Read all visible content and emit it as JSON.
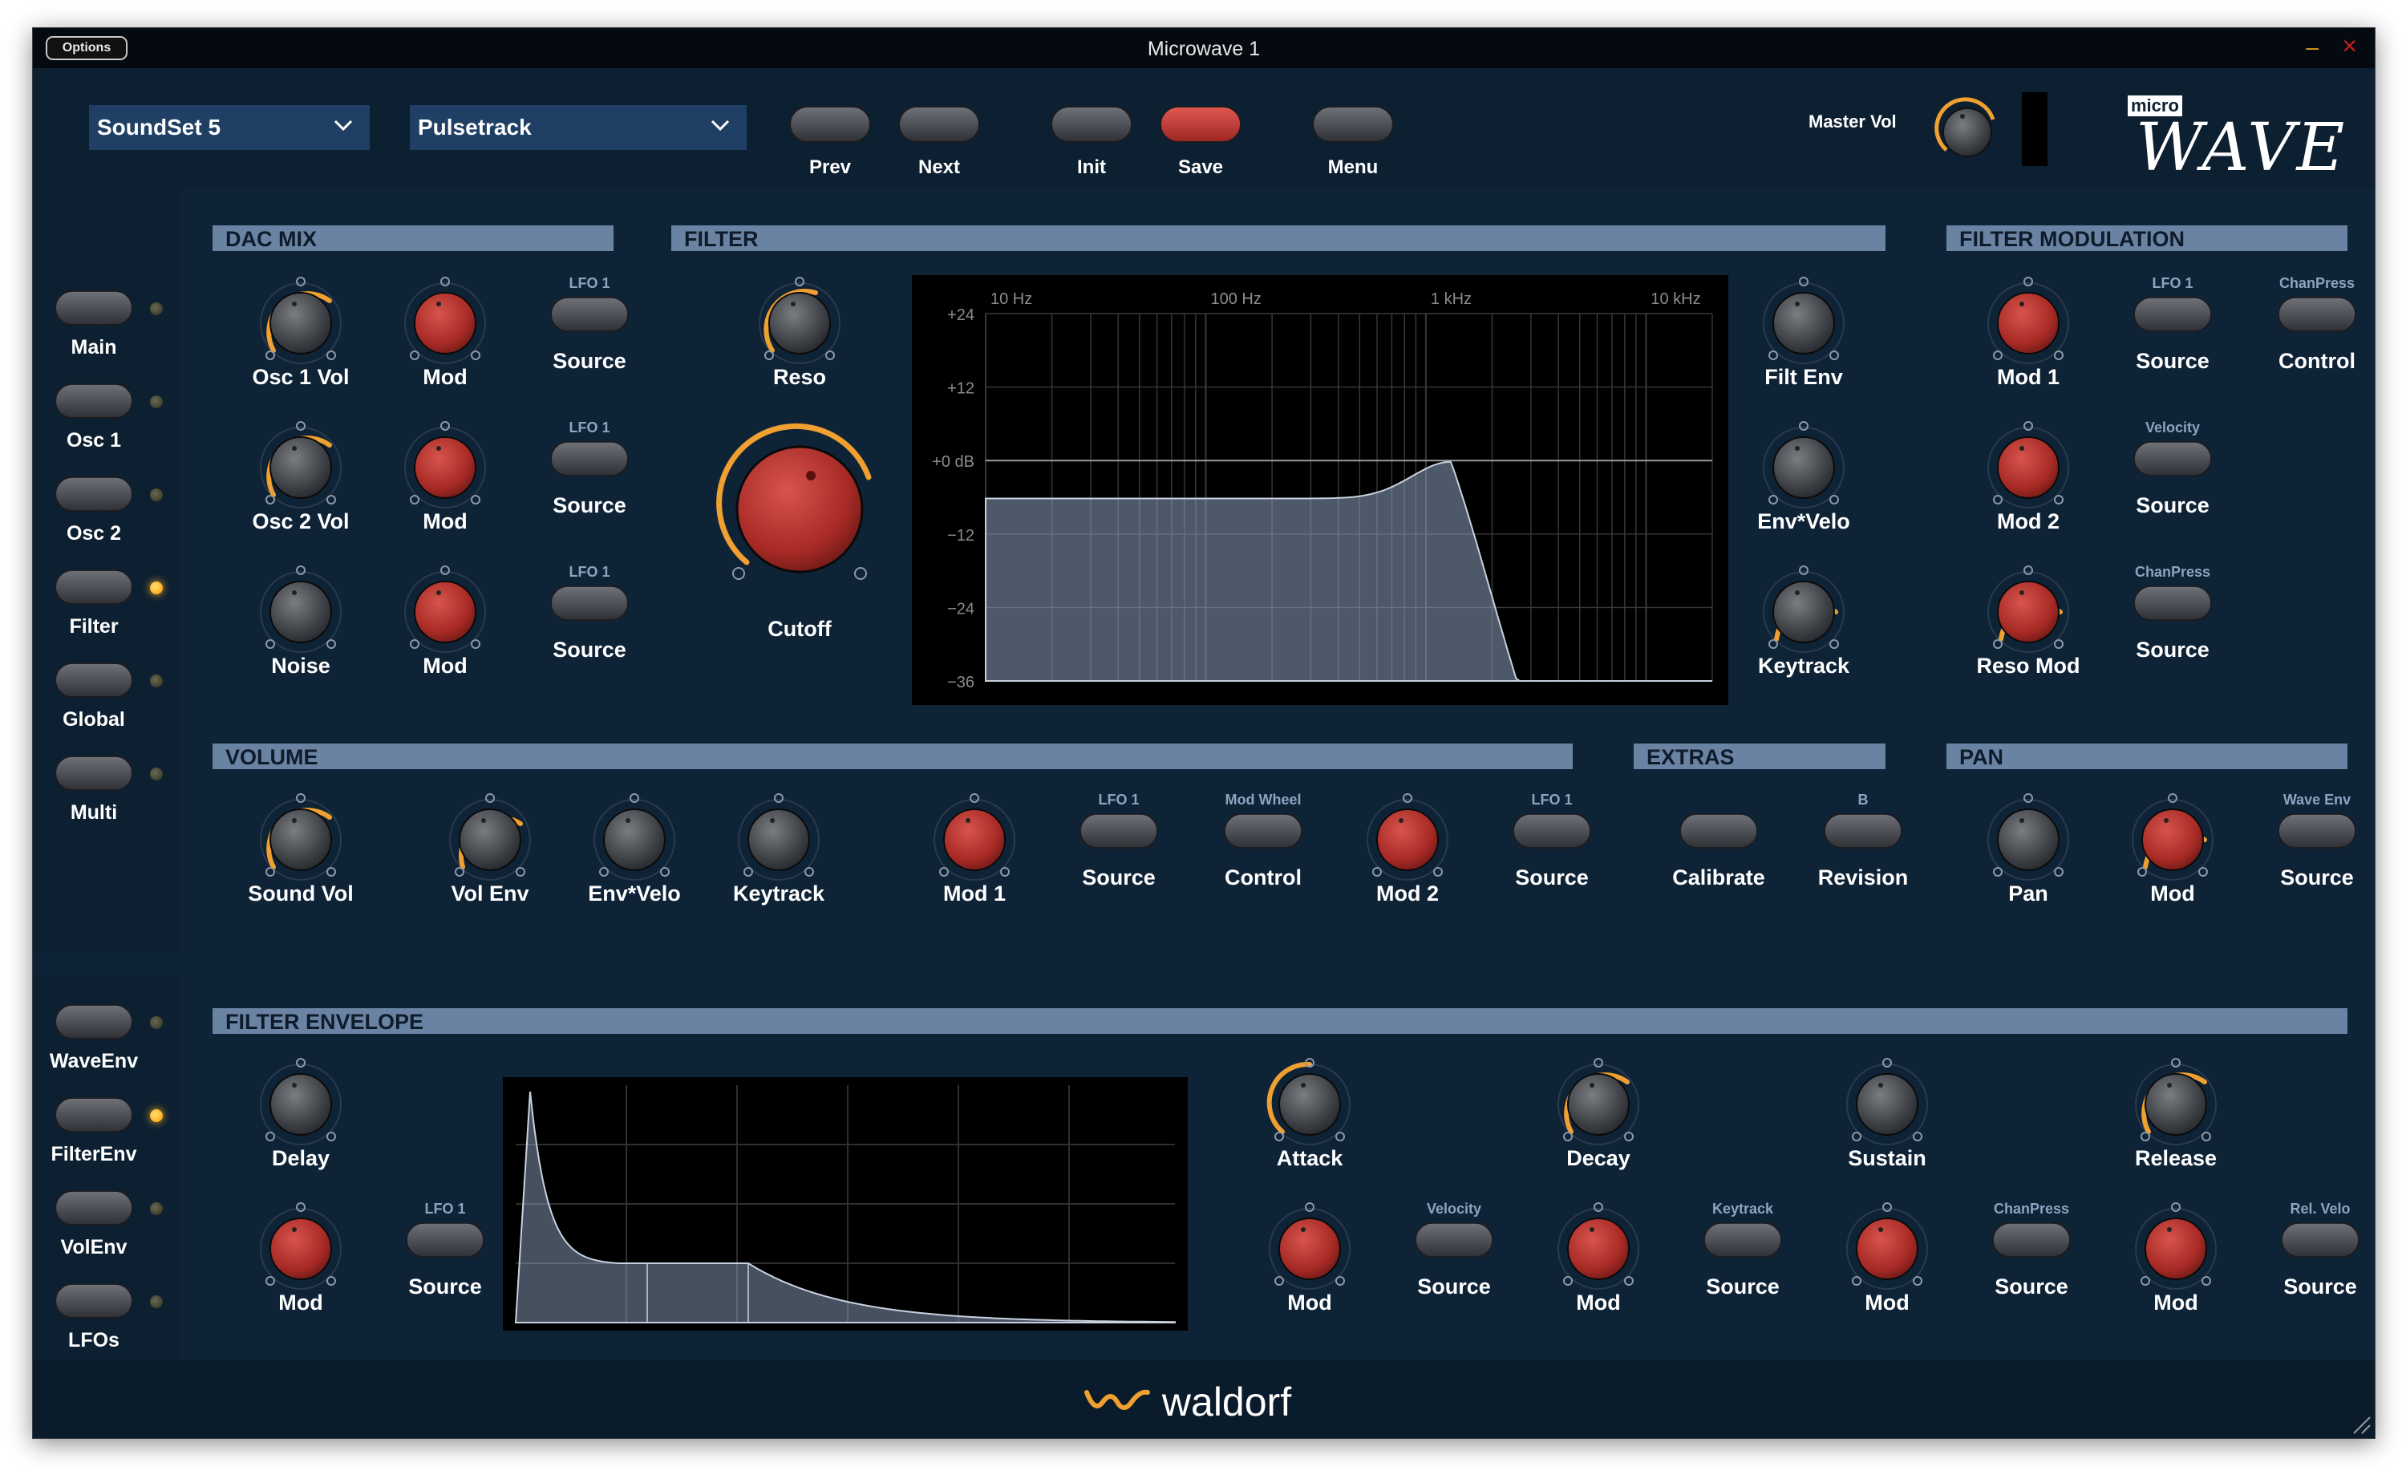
{
  "window": {
    "title": "Microwave 1",
    "options_label": "Options"
  },
  "topbar": {
    "soundset": "SoundSet 5",
    "patch": "Pulsetrack",
    "prev": "Prev",
    "next": "Next",
    "init": "Init",
    "save": "Save",
    "menu": "Menu",
    "master_vol": "Master Vol",
    "logo_micro": "micro",
    "logo_wave": "WAVE"
  },
  "sidebar_top": [
    "Main",
    "Osc 1",
    "Osc 2",
    "Filter",
    "Global",
    "Multi"
  ],
  "sidebar_top_active": "Filter",
  "sidebar_bottom": [
    "WaveEnv",
    "FilterEnv",
    "VolEnv",
    "LFOs"
  ],
  "sidebar_bottom_active": "FilterEnv",
  "dacmix": {
    "title": "DAC MIX",
    "rows": [
      {
        "knob": "Osc 1 Vol",
        "mod": "Mod",
        "src_top": "LFO 1",
        "src": "Source"
      },
      {
        "knob": "Osc 2 Vol",
        "mod": "Mod",
        "src_top": "LFO 1",
        "src": "Source"
      },
      {
        "knob": "Noise",
        "mod": "Mod",
        "src_top": "LFO 1",
        "src": "Source"
      }
    ]
  },
  "filter": {
    "title": "FILTER",
    "reso": "Reso",
    "cutoff": "Cutoff",
    "freq_labels": [
      "10 Hz",
      "100 Hz",
      "1 kHz",
      "10 kHz"
    ],
    "db_labels": [
      "+24",
      "+12",
      "+0 dB",
      "−12",
      "−24",
      "−36"
    ],
    "right_knobs": [
      "Filt Env",
      "Env*Velo",
      "Keytrack"
    ]
  },
  "filter_mod": {
    "title": "FILTER MODULATION",
    "rows": [
      {
        "mod": "Mod 1",
        "src_top": "LFO 1",
        "src": "Source",
        "ctl_top": "ChanPress",
        "ctl": "Control"
      },
      {
        "mod": "Mod 2",
        "src_top": "Velocity",
        "src": "Source"
      },
      {
        "mod": "Reso Mod",
        "src_top": "ChanPress",
        "src": "Source"
      }
    ]
  },
  "volume": {
    "title": "VOLUME",
    "sound_vol": "Sound Vol",
    "vol_env": "Vol Env",
    "env_velo": "Env*Velo",
    "keytrack": "Keytrack",
    "mod1": "Mod 1",
    "src1_top": "LFO 1",
    "src1": "Source",
    "ctl_top": "Mod Wheel",
    "ctl": "Control",
    "mod2": "Mod 2",
    "src2_top": "LFO 1",
    "src2": "Source"
  },
  "extras": {
    "title": "EXTRAS",
    "calibrate": "Calibrate",
    "revision_top": "B",
    "revision": "Revision"
  },
  "pan": {
    "title": "PAN",
    "pan": "Pan",
    "mod": "Mod",
    "src_top": "Wave Env",
    "src": "Source"
  },
  "filter_env": {
    "title": "FILTER ENVELOPE",
    "delay": "Delay",
    "mod": "Mod",
    "src_top": "LFO 1",
    "src": "Source",
    "stages": [
      {
        "name": "Attack",
        "mod": "Mod",
        "src_top": "Velocity",
        "src": "Source"
      },
      {
        "name": "Decay",
        "mod": "Mod",
        "src_top": "Keytrack",
        "src": "Source"
      },
      {
        "name": "Sustain",
        "mod": "Mod",
        "src_top": "ChanPress",
        "src": "Source"
      },
      {
        "name": "Release",
        "mod": "Mod",
        "src_top": "Rel. Velo",
        "src": "Source"
      }
    ]
  },
  "footer": {
    "brand": "waldorf"
  },
  "colors": {
    "background": "#0f2337",
    "section_bar": "#6b83a3",
    "knob_red": "#b8302b",
    "arc_orange": "#f0a030",
    "save_red": "#c23a36"
  }
}
